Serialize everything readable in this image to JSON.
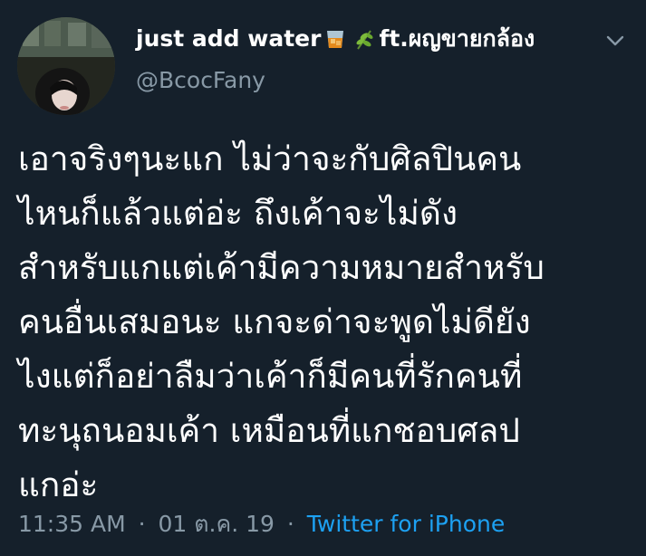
{
  "tweet": {
    "author": {
      "name_prefix": "just add water",
      "name_suffix": "ft.ผญขายกล้อง",
      "name_emojis": [
        "tumbler-glass-emoji",
        "herb-emoji"
      ],
      "handle": "@BcocFany"
    },
    "text": "เอาจริงๆนะแก ไม่ว่าจะกับศิลปินคน\nไหนก็แล้วแต่อ่ะ ถึงเค้าจะไม่ดัง\nสำหรับแกแต่เค้ามีความหมายสำหรับ\nคนอื่นเสมอนะ แกจะด่าจะพูดไม่ดียัง\nไงแต่ก็อย่าลืมว่าเค้าก็มีคนที่รักคนที่\nทะนุถนอมเค้า เหมือนที่แกชอบศลป\nแกอ่ะ",
    "time": "11:35 AM",
    "date": "01 ต.ค. 19",
    "separator": "·",
    "source": "Twitter for iPhone"
  },
  "colors": {
    "background": "#15202b",
    "text": "#ffffff",
    "muted": "#8899a6",
    "link": "#1da1f2"
  },
  "icons": {
    "more": "chevron-down-icon"
  }
}
